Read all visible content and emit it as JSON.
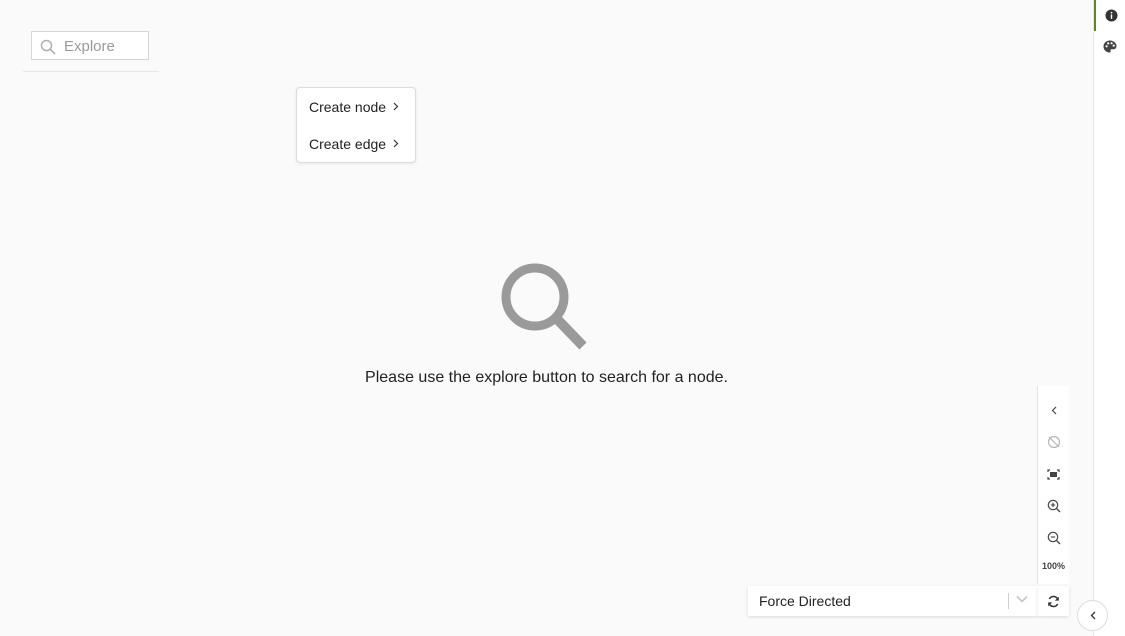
{
  "explore": {
    "placeholder": "Explore",
    "value": ""
  },
  "context_menu": {
    "items": [
      {
        "label": "Create node",
        "icon": "chevron-right-icon"
      },
      {
        "label": "Create edge",
        "icon": "chevron-right-icon"
      }
    ]
  },
  "empty_state": {
    "icon": "search-icon",
    "message": "Please use the explore button to search for a node."
  },
  "zoom_toolbar": {
    "buttons": [
      {
        "icon": "chevron-left-icon"
      },
      {
        "icon": "hide-icon"
      },
      {
        "icon": "fit-view-icon"
      },
      {
        "icon": "zoom-in-icon"
      },
      {
        "icon": "zoom-out-icon"
      }
    ],
    "zoom_level": "100%"
  },
  "layout": {
    "selected": "Force Directed",
    "refresh_icon": "refresh-icon"
  },
  "right_sidebar": {
    "buttons": [
      {
        "icon": "info-icon",
        "active": true
      },
      {
        "icon": "palette-icon",
        "active": false
      }
    ],
    "accent_color": "#5b8a1e"
  },
  "collapse_button": {
    "icon": "chevron-left-icon"
  }
}
